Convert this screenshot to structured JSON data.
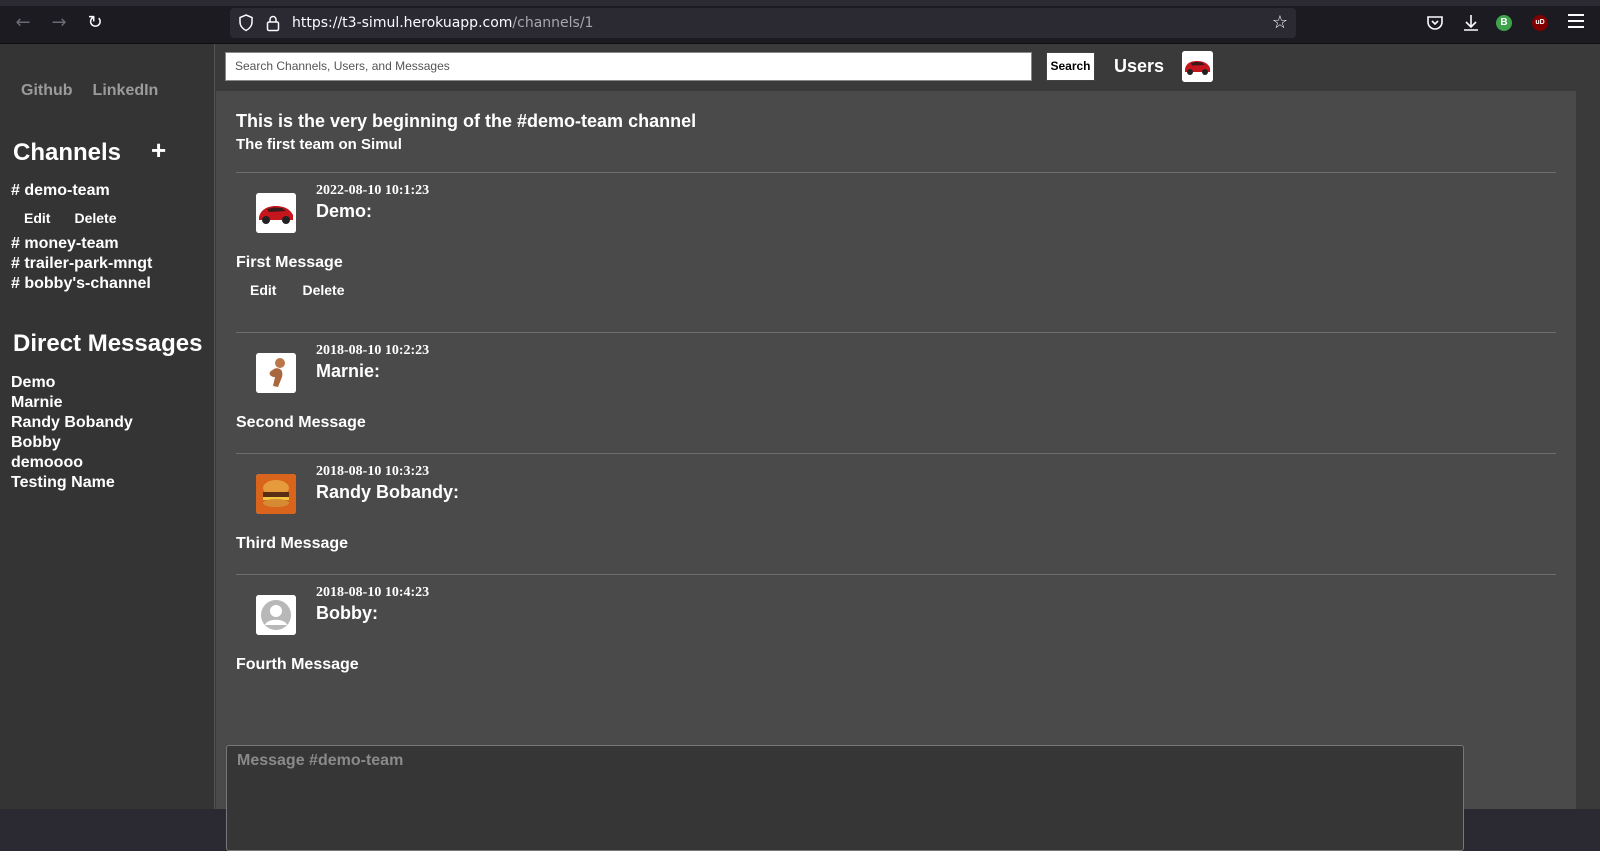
{
  "browser": {
    "url_host": "https://t3-simul.herokuapp.com",
    "url_path": "/channels/1"
  },
  "extensions": {
    "b_label": "B",
    "ub_label": "uD"
  },
  "sidebar": {
    "links": [
      "Github",
      "LinkedIn"
    ],
    "channels_heading": "Channels",
    "add_label": "+",
    "channels": [
      "# demo-team",
      "# money-team",
      "# trailer-park-mngt",
      "# bobby's-channel"
    ],
    "channel_actions": {
      "edit": "Edit",
      "delete": "Delete"
    },
    "dm_heading": "Direct Messages",
    "dms": [
      "Demo",
      "Marnie",
      "Randy Bobandy",
      "Bobby",
      "demoooo",
      "Testing Name"
    ]
  },
  "topbar": {
    "search_placeholder": "Search Channels, Users, and Messages",
    "search_button": "Search",
    "users_label": "Users"
  },
  "channel": {
    "intro": "This is the very beginning of the #demo-team channel",
    "description": "The first team on Simul"
  },
  "messages": [
    {
      "time": "2022-08-10 10:1:23",
      "author": "Demo:",
      "text": "First Message",
      "edit": "Edit",
      "delete": "Delete",
      "avatar": "red-car"
    },
    {
      "time": "2018-08-10 10:2:23",
      "author": "Marnie:",
      "text": "Second Message",
      "avatar": "figure"
    },
    {
      "time": "2018-08-10 10:3:23",
      "author": "Randy Bobandy:",
      "text": "Third Message",
      "avatar": "burger"
    },
    {
      "time": "2018-08-10 10:4:23",
      "author": "Bobby:",
      "text": "Fourth Message",
      "avatar": "default-user"
    }
  ],
  "composer": {
    "placeholder": "Message #demo-team"
  },
  "colors": {
    "sidebar_bg": "#343434",
    "main_bg": "#4a4a4a",
    "text": "#ffffff",
    "muted_link": "#9b9b9b"
  }
}
